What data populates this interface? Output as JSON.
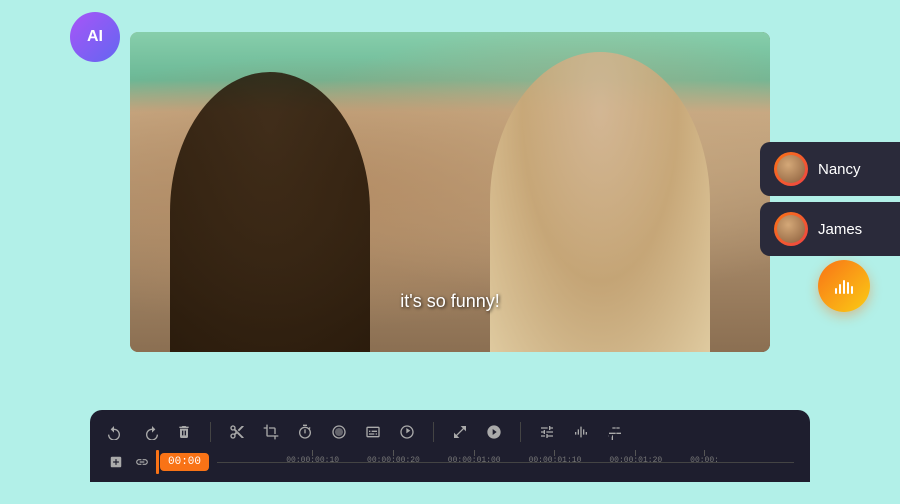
{
  "background_color": "#b2f0e8",
  "ai_badge": {
    "label": "AI"
  },
  "subtitle": {
    "text": "it's so funny!"
  },
  "speakers": [
    {
      "name": "Nancy",
      "avatar_gradient": "linear-gradient(135deg, #f97316, #ef4444)"
    },
    {
      "name": "James",
      "avatar_gradient": "linear-gradient(135deg, #f97316, #ef4444)"
    }
  ],
  "toolbar": {
    "icons": [
      {
        "name": "undo",
        "symbol": "↩"
      },
      {
        "name": "redo",
        "symbol": "↪"
      },
      {
        "name": "delete",
        "symbol": "🗑"
      },
      {
        "name": "cut",
        "symbol": "✂"
      },
      {
        "name": "crop",
        "symbol": "⊡"
      },
      {
        "name": "timer",
        "symbol": "⏱"
      },
      {
        "name": "effects",
        "symbol": "✦"
      },
      {
        "name": "caption",
        "symbol": "⊟"
      },
      {
        "name": "clock",
        "symbol": "⊙"
      },
      {
        "name": "expand",
        "symbol": "⊞"
      },
      {
        "name": "overlay",
        "symbol": "◈"
      },
      {
        "name": "adjustments",
        "symbol": "⊟"
      },
      {
        "name": "waveform",
        "symbol": "⊞"
      },
      {
        "name": "tune",
        "symbol": "⊠"
      }
    ]
  },
  "timeline": {
    "current_time": "00:00",
    "markers": [
      {
        "label": "00:00:00:10",
        "position": 13
      },
      {
        "label": "00:00:00:20",
        "position": 26
      },
      {
        "label": "00:00:01:00",
        "position": 39
      },
      {
        "label": "00:00:01:10",
        "position": 52
      },
      {
        "label": "00:00:01:20",
        "position": 65
      },
      {
        "label": "00:00:",
        "position": 78
      }
    ]
  },
  "fab": {
    "symbol": "📊"
  }
}
